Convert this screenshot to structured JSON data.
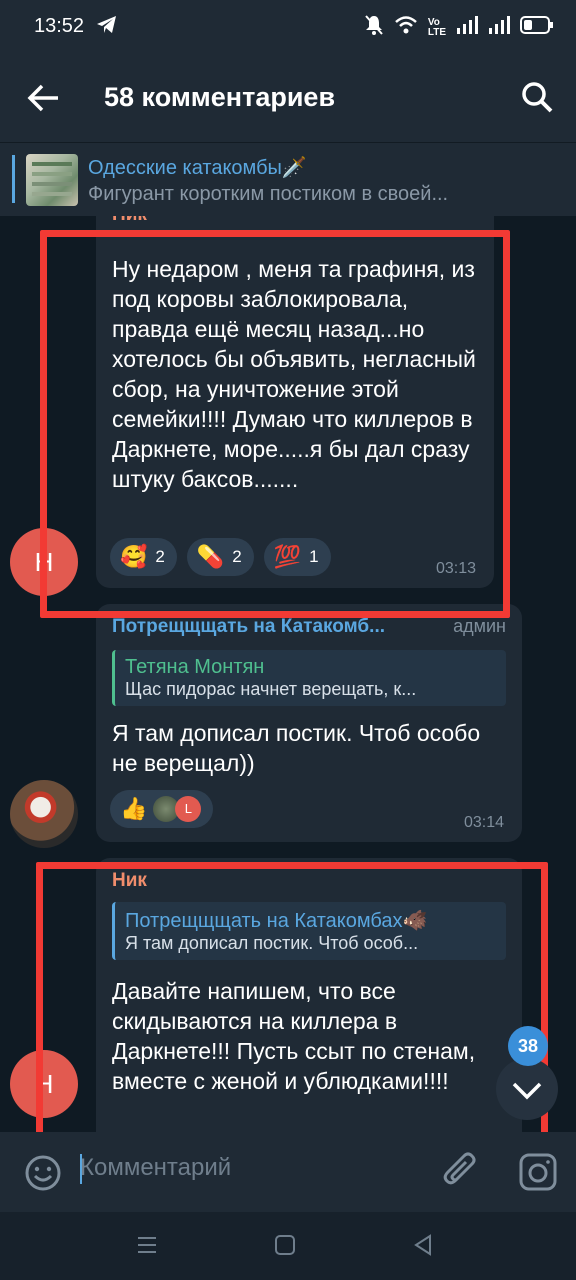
{
  "status": {
    "time": "13:52",
    "indicators": [
      "telegram-icon",
      "mute-icon",
      "wifi-icon",
      "volte-icon",
      "signal-icon",
      "signal-icon",
      "battery-icon"
    ]
  },
  "header": {
    "back_icon": "back-arrow-icon",
    "title": "58 комментариев",
    "search_icon": "search-icon"
  },
  "pinned": {
    "channel": "Одесские катакомбы🗡️",
    "preview": "Фигурант коротким постиком в своей..."
  },
  "messages": [
    {
      "author": "Ник",
      "avatar_letter": "Н",
      "text": "Ну недаром , меня та графиня, из под коровы заблокировала, правда ещё месяц назад...но хотелось бы объявить, негласный сбор, на уничтожение этой семейки!!!! Думаю что киллеров в Даркнете, море.....я бы дал сразу штуку баксов.......",
      "reactions": [
        {
          "emoji": "🥰",
          "count": "2"
        },
        {
          "emoji": "💊",
          "count": "2"
        },
        {
          "emoji": "💯",
          "count": "1"
        }
      ],
      "time": "03:13"
    },
    {
      "author": "Потрещщщать на Катакомб...",
      "role": "админ",
      "reply_to": {
        "name": "Тетяна Монтян",
        "text": "Щас пидорас начнет верещать, к..."
      },
      "text": "Я там дописал постик. Чтоб особо не верещал))",
      "reactions": [
        {
          "emoji": "👍",
          "count": ""
        }
      ],
      "reaction_user_letter": "L",
      "time": "03:14"
    },
    {
      "author": "Ник",
      "avatar_letter": "Н",
      "reply_to": {
        "name": "Потрещщщать на Катакомбах🐗",
        "text": "Я там дописал постик. Чтоб особ..."
      },
      "text": "Давайте напишем, что все скидываются на киллера в Даркнете!!! Пусть ссыт по стенам, вместе с женой и ублюдками!!!!"
    }
  ],
  "scroll_badge": "38",
  "input": {
    "placeholder": "Комментарий"
  },
  "colors": {
    "accent": "#5aa7e0",
    "author_orange": "#f08d6c",
    "highlight_red": "#f23a34",
    "bubble": "#1f2a35"
  }
}
